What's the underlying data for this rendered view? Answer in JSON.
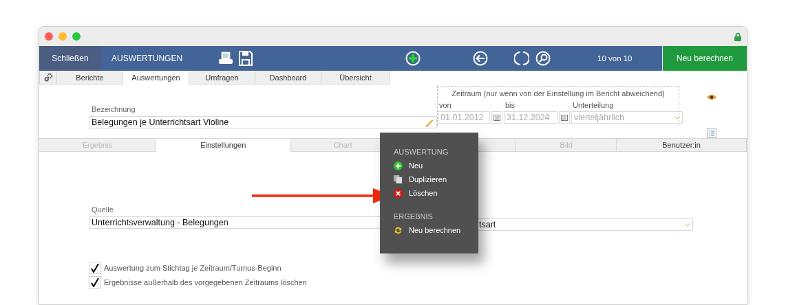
{
  "toolbar": {
    "close_button": "Schließen",
    "title": "AUSWERTUNGEN",
    "record_counter": "10 von 10",
    "recalculate_button": "Neu berechnen"
  },
  "top_tabs": [
    {
      "label": "Berichte",
      "selected": false
    },
    {
      "label": "Auswertungen",
      "selected": true
    },
    {
      "label": "Umfragen",
      "selected": false
    },
    {
      "label": "Dashboard",
      "selected": false
    },
    {
      "label": "Übersicht",
      "selected": false
    }
  ],
  "header_form": {
    "name_label": "Bezeichnung",
    "name_value": "Belegungen je Unterrichtsart Violine",
    "period": {
      "caption": "Zeitraum (nur wenn von der Einstellung im Bericht abweichend)",
      "disabled": true,
      "from_label": "von",
      "from_value": "01.01.2012",
      "to_label": "bis",
      "to_value": "31.12.2024",
      "division_label": "Unterteilung",
      "division_value": "vierteljährlich"
    }
  },
  "sub_tabs": [
    {
      "label": "Ergebnis",
      "selected": false,
      "disabled": true
    },
    {
      "label": "Einstellungen",
      "selected": true,
      "disabled": false
    },
    {
      "label": "Chart",
      "selected": false,
      "disabled": true
    },
    {
      "selected": false
    },
    {
      "label": "Bild",
      "selected": false,
      "disabled": true
    },
    {
      "label": "Benutzer:in",
      "selected": false,
      "disabled": false
    }
  ],
  "settings": {
    "source_label": "Quelle",
    "source_value": "Unterrichtsverwaltung - Belegungen",
    "division_value_visible_part": "tsart",
    "options": [
      {
        "label": "Auswertung zum Stichtag je Zeitraum/Turnus-Beginn",
        "checked": true
      },
      {
        "label": "Ergebnisse außerhalb des vorgegebenen Zeitraums löschen",
        "checked": true
      }
    ]
  },
  "context_menu": {
    "sections": [
      {
        "title": "AUSWERTUNG",
        "items": [
          {
            "label": "Neu",
            "kind": "new"
          },
          {
            "label": "Duplizieren",
            "kind": "duplicate"
          },
          {
            "label": "Löschen",
            "kind": "delete"
          }
        ]
      },
      {
        "title": "ERGEBNIS",
        "items": [
          {
            "label": "Neu berechnen",
            "kind": "recalculate"
          }
        ]
      }
    ]
  }
}
